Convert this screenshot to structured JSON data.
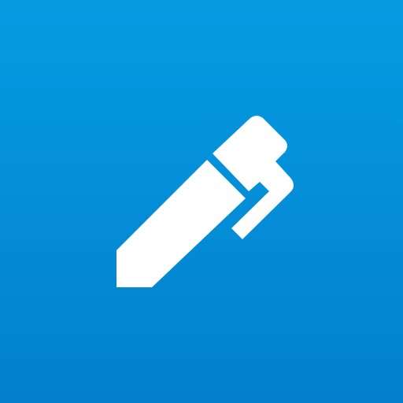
{
  "app_icon": {
    "icon": "pen-icon",
    "background_top_color": "#059ce2",
    "background_bottom_color": "#0380cc",
    "glyph_color": "#ffffff"
  }
}
